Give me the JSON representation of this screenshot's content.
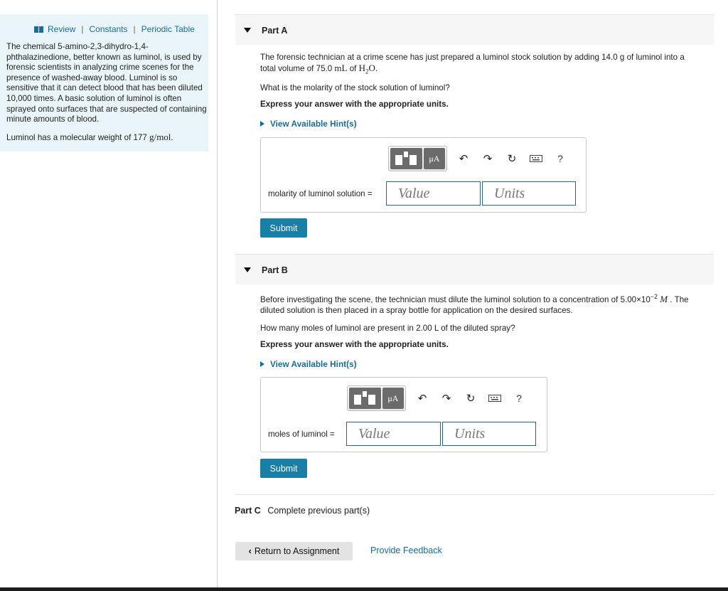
{
  "left": {
    "links": [
      "Review",
      "Constants",
      "Periodic Table"
    ],
    "separator": "|",
    "intro": "The chemical 5-amino-2,3-dihydro-1,4-phthalazinedione, better known as luminol, is used by forensic scientists in analyzing crime scenes for the presence of washed-away blood. Luminol is so sensitive that it can detect blood that has been diluted 10,000 times. A basic solution of luminol is often sprayed onto surfaces that are suspected of containing minute amounts of blood.",
    "mw_prefix": "Luminol has a molecular weight of 177 ",
    "mw_unit": "g/mol",
    "mw_suffix": "."
  },
  "partA": {
    "title": "Part A",
    "q1a": "The forensic technician at a crime scene has just prepared a luminol stock solution by adding  14.0 g of luminol into a",
    "q1b_prefix": "total volume of 75.0 ",
    "q1b_unit": "mL",
    "q1b_mid": " of ",
    "q1b_h2o": "H",
    "q1b_sub": "2",
    "q1b_o": "O",
    "q1b_end": ".",
    "question": "What is the molarity of the stock solution of luminol?",
    "instruction": "Express your answer with the appropriate units.",
    "hint": "View Available Hint(s)",
    "mu_label": "μA",
    "help": "?",
    "answer_label": "molarity of luminol solution =",
    "value_placeholder": "Value",
    "units_placeholder": "Units",
    "submit": "Submit"
  },
  "partB": {
    "title": "Part B",
    "q1a_prefix": "Before investigating the scene, the technician must dilute the luminol solution to a concentration of 5.00×10",
    "q1a_sup": "−2",
    "q1a_unit": "M",
    "q1a_suffix": ". The",
    "q1b": "diluted solution is then placed in a spray bottle for application on the desired surfaces.",
    "question": "How many moles of luminol are present in 2.00 L of the diluted spray?",
    "instruction": "Express your answer with the appropriate units.",
    "hint": "View Available Hint(s)",
    "mu_label": "μA",
    "help": "?",
    "answer_label": "moles of luminol =",
    "value_placeholder": "Value",
    "units_placeholder": "Units",
    "submit": "Submit"
  },
  "partC": {
    "title": "Part C",
    "status": "Complete previous part(s)"
  },
  "footer": {
    "back": "Return to Assignment",
    "feedback": "Provide Feedback"
  }
}
